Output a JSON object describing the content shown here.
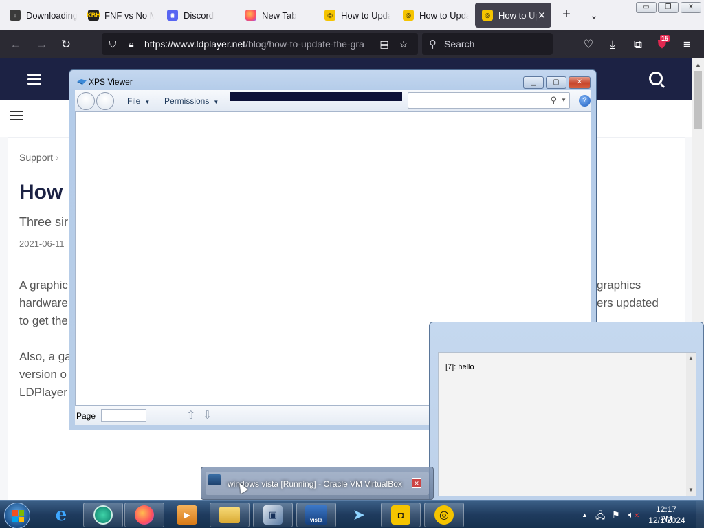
{
  "browser": {
    "tabs": [
      {
        "label": "Downloading",
        "favicon": "download-icon",
        "active": false
      },
      {
        "label": "FNF vs No Mo",
        "favicon": "fnf-icon",
        "active": false
      },
      {
        "label": "Discord",
        "favicon": "discord-icon",
        "active": false
      },
      {
        "label": "New Tab",
        "favicon": "firefox-icon",
        "active": false
      },
      {
        "label": "How to Upda",
        "favicon": "ldplayer-icon",
        "active": false
      },
      {
        "label": "How to Upda",
        "favicon": "ldplayer-icon",
        "active": false
      },
      {
        "label": "How to Up",
        "favicon": "ldplayer-icon",
        "active": true
      }
    ],
    "fnf_favicon_text": "KBH",
    "url_main": "https://www.ldplayer.net",
    "url_rest": "/blog/how-to-update-the-gra",
    "search_placeholder": "Search",
    "extension_badge": "15",
    "colors": {
      "toolbar_bg": "#2b2a33",
      "tabbar_bg": "#f0f0f4",
      "active_tab": "#42414d"
    }
  },
  "website": {
    "breadcrumb": "Support",
    "title": "How",
    "subtitle": "Three sir",
    "date": "2021-06-11",
    "para1_line1_left": "A graphic",
    "para1_line1_right": "graphics",
    "para1_line2_left": "hardware",
    "para1_line2_right": "ers updated",
    "para1_line3_left": "to get the",
    "para2_line1_left": "Also, a ga",
    "para2_line2_left": "version o",
    "para2_line3_left": "LDPlayer",
    "colors": {
      "header_bg": "#1c2244",
      "text": "#555555"
    }
  },
  "xps_viewer": {
    "title": "XPS Viewer",
    "menu_file": "File",
    "menu_permissions": "Permissions",
    "help_symbol": "?",
    "page_label": "Page",
    "page_value": ""
  },
  "chat": {
    "message": "[7]: hello"
  },
  "taskbar_thumbnail": {
    "label": "windows vista [Running] - Oracle VM VirtualBox"
  },
  "taskbar": {
    "pinned": [
      "start-orb",
      "ie-icon",
      "app-icon",
      "firefox-icon",
      "media-icon",
      "explorer-icon",
      "virtualbox-icon",
      "vista-vm-icon",
      "telegram-icon",
      "ldplayer-multi-icon",
      "ldplayer-icon"
    ],
    "vista_icon_label": "vista",
    "clock_time": "12:17 PM",
    "clock_date": "12/1/2024"
  }
}
